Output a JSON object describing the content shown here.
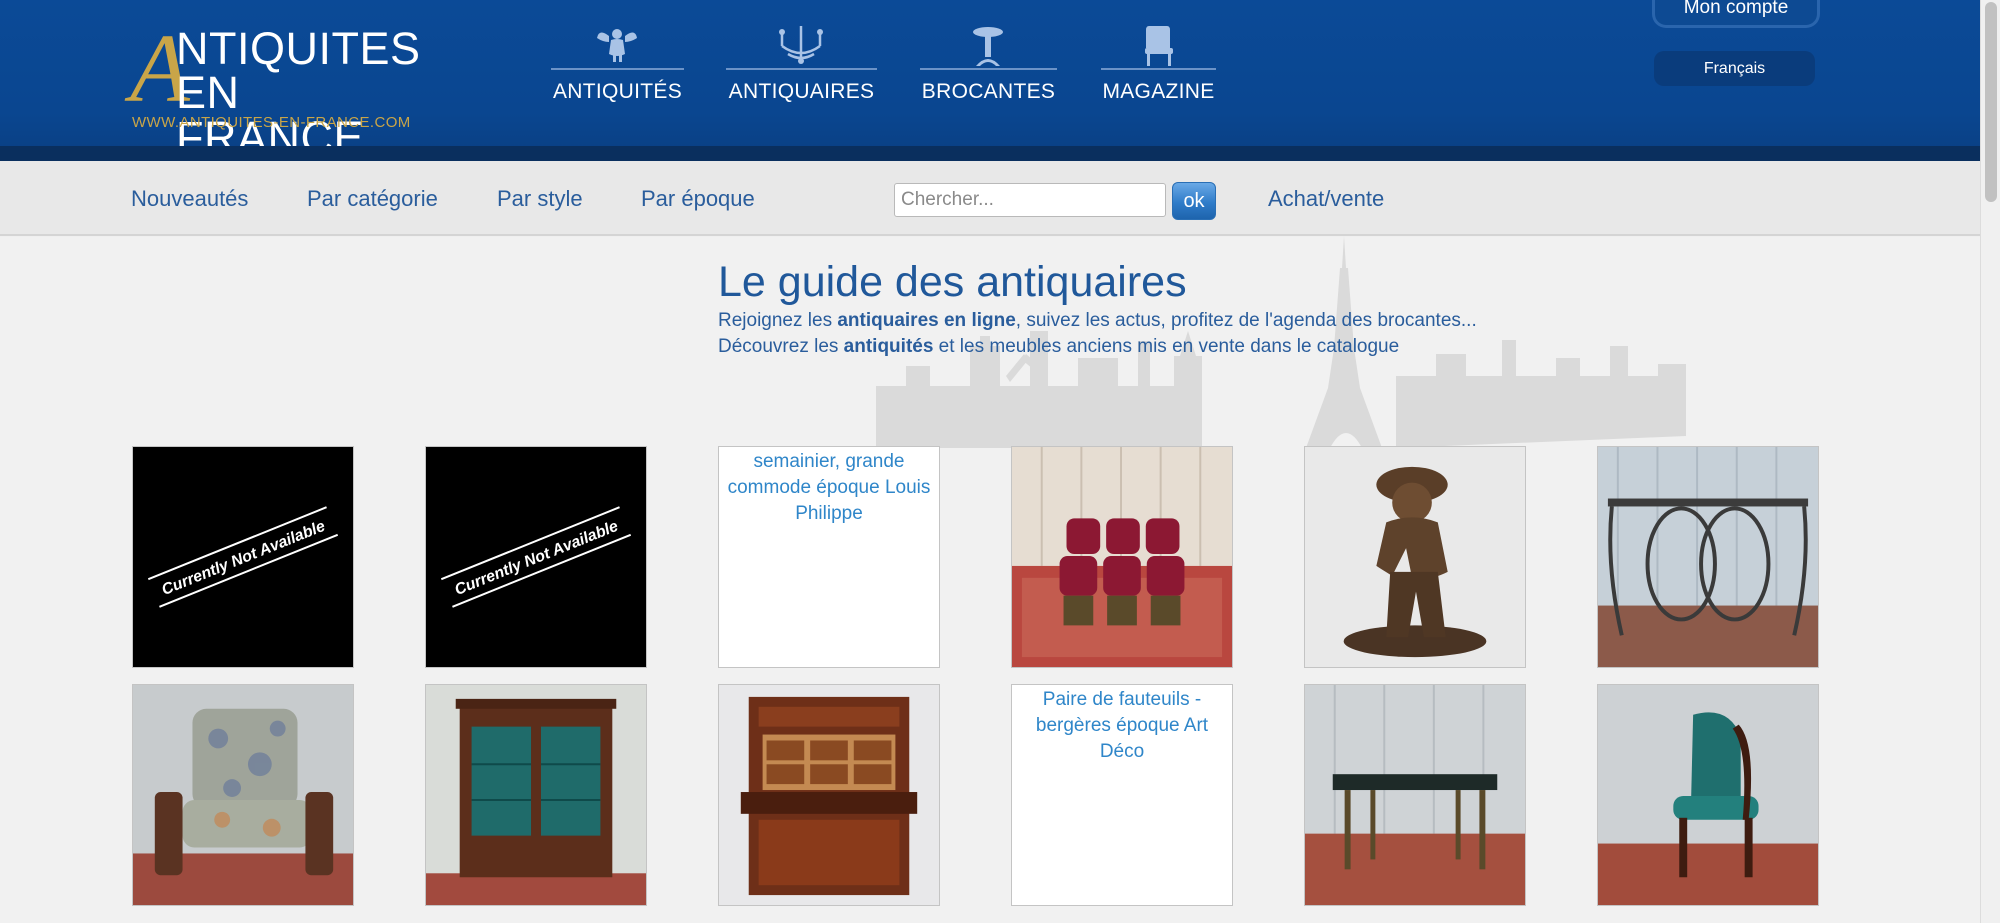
{
  "brand": {
    "logo_a": "A",
    "line1": "NTIQUITES",
    "line2": "EN FRANCE",
    "url": "WWW.ANTIQUITES-EN-FRANCE.COM",
    "gold": "#c9a548",
    "blue": "#0b4a97"
  },
  "main_nav": [
    {
      "label": "ANTIQUITÉS",
      "icon": "cherub-icon"
    },
    {
      "label": "ANTIQUAIRES",
      "icon": "chandelier-icon"
    },
    {
      "label": "BROCANTES",
      "icon": "pedestal-table-icon"
    },
    {
      "label": "MAGAZINE",
      "icon": "armchair-icon"
    }
  ],
  "account": {
    "label": "Mon compte"
  },
  "language": {
    "label": "Français"
  },
  "sub_nav": {
    "links": [
      "Nouveautés",
      "Par catégorie",
      "Par style",
      "Par époque"
    ],
    "search_placeholder": "Chercher...",
    "search_button": "ok",
    "achat": "Achat/vente"
  },
  "guide": {
    "title": "Le guide des antiquaires",
    "line1_pre": "Rejoignez les ",
    "line1_bold": "antiquaires en ligne",
    "line1_post": ", suivez les actus, profitez de l'agenda des brocantes...",
    "line2_pre": "Découvrez les ",
    "line2_bold": "antiquités",
    "line2_post": " et les meubles anciens mis en vente dans le catalogue"
  },
  "products": [
    {
      "kind": "unavailable",
      "text": "Currently Not Available"
    },
    {
      "kind": "unavailable",
      "text": "Currently Not Available"
    },
    {
      "kind": "broken",
      "alt": "semainier, grande commode époque Louis Philippe"
    },
    {
      "kind": "photo",
      "subject": "red-velvet-chairs"
    },
    {
      "kind": "photo",
      "subject": "bronze-boy-statue"
    },
    {
      "kind": "photo",
      "subject": "metal-console-table"
    },
    {
      "kind": "photo",
      "subject": "floral-armchair"
    },
    {
      "kind": "photo",
      "subject": "glass-bookcase"
    },
    {
      "kind": "photo",
      "subject": "secretary-desk"
    },
    {
      "kind": "broken",
      "alt": "Paire de fauteuils - bergères époque Art Déco"
    },
    {
      "kind": "photo",
      "subject": "marble-top-table"
    },
    {
      "kind": "photo",
      "subject": "teal-leather-chair"
    }
  ]
}
